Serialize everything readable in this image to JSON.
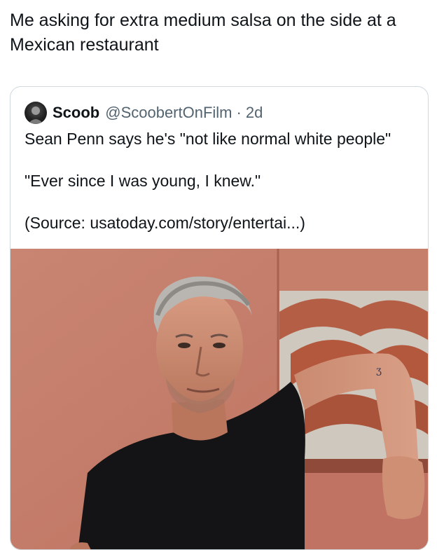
{
  "post": {
    "text": "Me asking for extra medium salsa on the side at a Mexican restaurant"
  },
  "quoted_tweet": {
    "display_name": "Scoob",
    "handle": "@ScoobertOnFilm",
    "separator": "·",
    "time": "2d",
    "lines": [
      "Sean Penn says he's \"not like normal white people\"",
      "\"Ever since I was young, I knew.\"",
      "(Source: usatoday.com/story/entertai...)"
    ],
    "avatar_icon": "avatar-dark-photo",
    "photo_icon": "portrait-photo"
  },
  "colors": {
    "text_primary": "#0f1419",
    "text_secondary": "#536471",
    "card_border": "#cfd9de",
    "wall": "#c9806e"
  }
}
